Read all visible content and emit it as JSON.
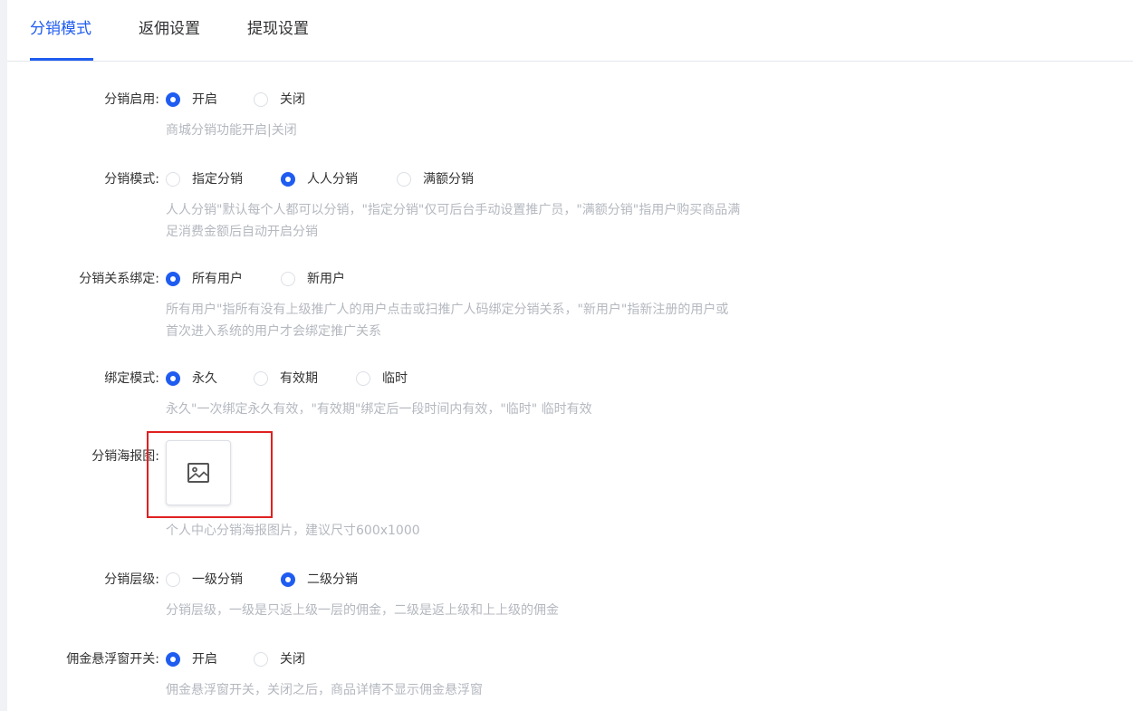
{
  "tabs": [
    {
      "label": "分销模式",
      "active": true
    },
    {
      "label": "返佣设置",
      "active": false
    },
    {
      "label": "提现设置",
      "active": false
    }
  ],
  "accent_color": "#1f5cf0",
  "form": {
    "enable": {
      "label": "分销启用:",
      "options": [
        "开启",
        "关闭"
      ],
      "selected": "开启",
      "hint": "商城分销功能开启|关闭"
    },
    "mode": {
      "label": "分销模式:",
      "options": [
        "指定分销",
        "人人分销",
        "满额分销"
      ],
      "selected": "人人分销",
      "hint1": "人人分销\"默认每个人都可以分销，\"指定分销\"仅可后台手动设置推广员，\"满额分销\"指用户购买商品满",
      "hint2": "足消费金额后自动开启分销"
    },
    "binding": {
      "label": "分销关系绑定:",
      "options": [
        "所有用户",
        "新用户"
      ],
      "selected": "所有用户",
      "hint1": "所有用户\"指所有没有上级推广人的用户点击或扫推广人码绑定分销关系，\"新用户\"指新注册的用户或",
      "hint2": "首次进入系统的用户才会绑定推广关系"
    },
    "bind_mode": {
      "label": "绑定模式:",
      "options": [
        "永久",
        "有效期",
        "临时"
      ],
      "selected": "永久",
      "hint": "永久\"一次绑定永久有效，\"有效期\"绑定后一段时间内有效，\"临时\" 临时有效"
    },
    "poster": {
      "label": "分销海报图:",
      "icon": "image-icon",
      "hint": "个人中心分销海报图片，建议尺寸600x1000"
    },
    "level": {
      "label": "分销层级:",
      "options": [
        "一级分销",
        "二级分销"
      ],
      "selected": "二级分销",
      "hint": "分销层级，一级是只返上级一层的佣金，二级是返上级和上上级的佣金"
    },
    "float_window": {
      "label": "佣金悬浮窗开关:",
      "options": [
        "开启",
        "关闭"
      ],
      "selected": "开启",
      "hint": "佣金悬浮窗开关，关闭之后，商品详情不显示佣金悬浮窗"
    }
  }
}
